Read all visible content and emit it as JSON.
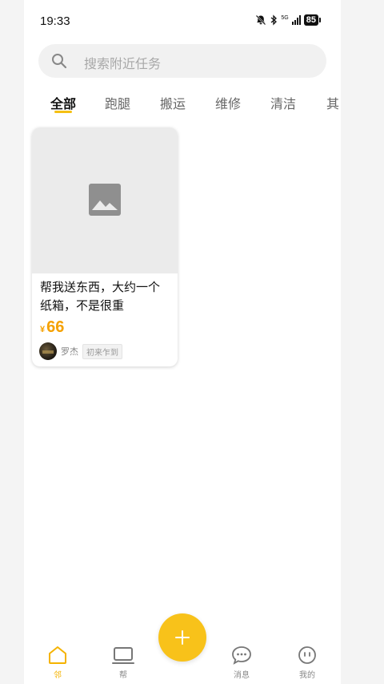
{
  "status_bar": {
    "time": "19:33",
    "network_label": "5G",
    "battery": "85"
  },
  "search": {
    "placeholder": "搜索附近任务"
  },
  "tabs": [
    {
      "label": "全部",
      "active": true
    },
    {
      "label": "跑腿",
      "active": false
    },
    {
      "label": "搬运",
      "active": false
    },
    {
      "label": "维修",
      "active": false
    },
    {
      "label": "清洁",
      "active": false
    },
    {
      "label": "其",
      "active": false
    }
  ],
  "task_card": {
    "title": "帮我送东西，大约一个纸箱，不是很重",
    "currency": "¥",
    "price": "66",
    "user_name": "罗杰",
    "user_tag": "初来乍到"
  },
  "bottom_nav": {
    "items": [
      {
        "label": "邻",
        "icon": "home-icon",
        "active": true
      },
      {
        "label": "帮",
        "icon": "laptop-icon",
        "active": false
      },
      {
        "label": "消息",
        "icon": "chat-icon",
        "active": false
      },
      {
        "label": "我的",
        "icon": "profile-icon",
        "active": false
      }
    ]
  },
  "colors": {
    "accent": "#f5c014",
    "price": "#f5a100",
    "fab": "#f8c21a"
  }
}
